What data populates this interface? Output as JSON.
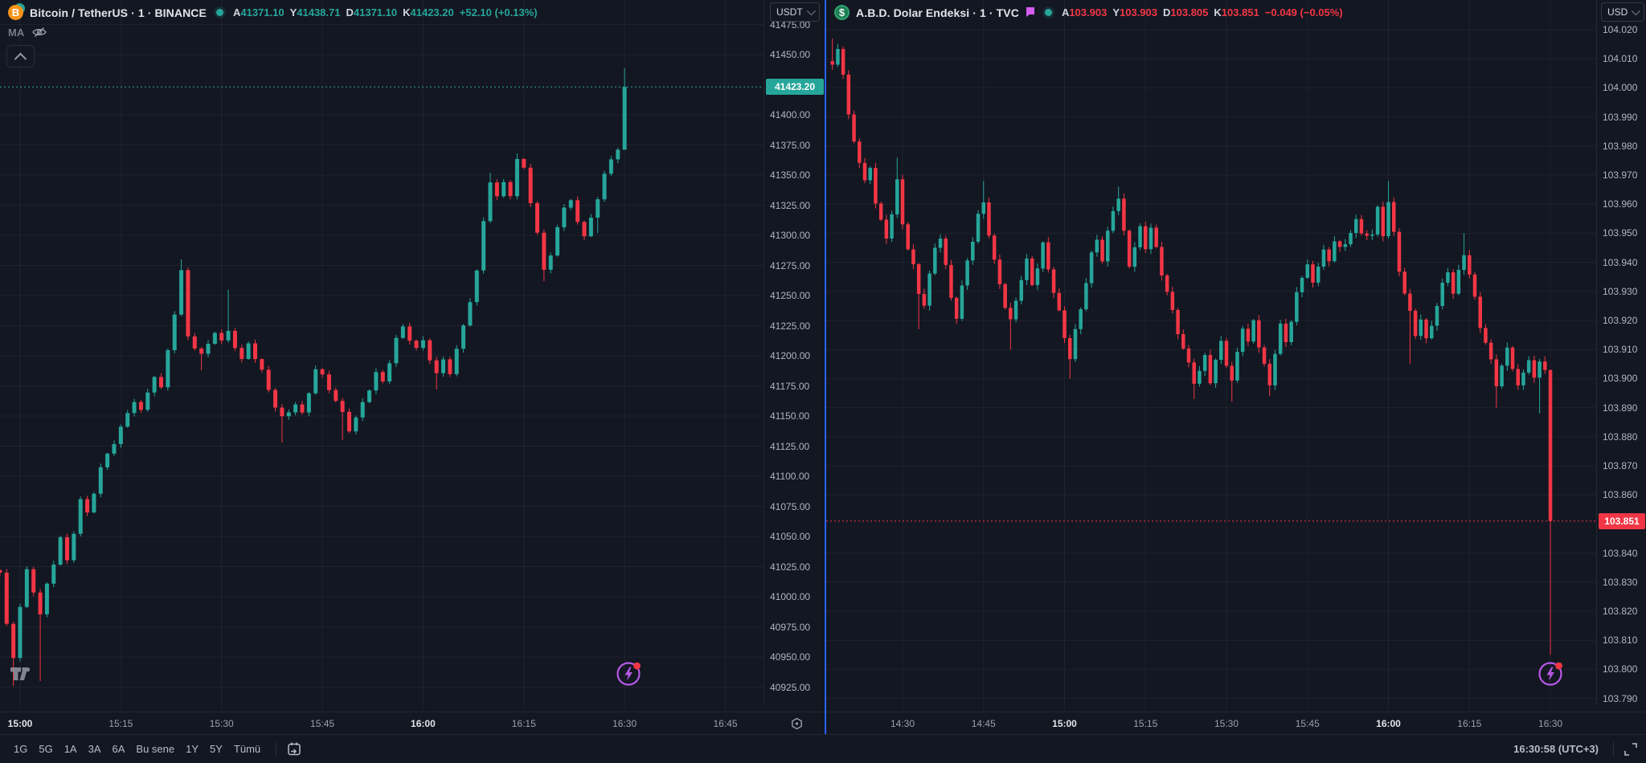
{
  "left_pane": {
    "header": {
      "title": "Bitcoin / TetherUS · 1 · BINANCE",
      "coin_glyph": "B",
      "ohlc": {
        "open_label": "A",
        "open": "41371.10",
        "high_label": "Y",
        "high": "41438.71",
        "low_label": "D",
        "low": "41371.10",
        "close_label": "K",
        "close": "41423.20",
        "change": "+52.10 (+0.13%)"
      }
    },
    "legend_indicator": "MA",
    "currency": "USDT",
    "last_price": "41423.20"
  },
  "right_pane": {
    "header": {
      "title": "A.B.D. Dolar Endeksi · 1 · TVC",
      "coin_glyph": "$",
      "ohlc": {
        "open_label": "A",
        "open": "103.903",
        "high_label": "Y",
        "high": "103.903",
        "low_label": "D",
        "low": "103.805",
        "close_label": "K",
        "close": "103.851",
        "change": "−0.049 (−0.05%)"
      }
    },
    "currency": "USD",
    "last_price": "103.851"
  },
  "toolbar": {
    "ranges": [
      "1G",
      "5G",
      "1A",
      "3A",
      "6A",
      "Bu sene",
      "1Y",
      "5Y",
      "Tümü"
    ],
    "clock": "16:30:58 (UTC+3)"
  },
  "colors": {
    "up": "#26a69a",
    "down": "#f23645",
    "accent_blue": "#2962ff",
    "flag_purple": "#d65cf0",
    "bolt_purple": "#b558e6"
  },
  "chart_data": [
    {
      "type": "candlestick",
      "title": "Bitcoin / TetherUS",
      "exchange": "BINANCE",
      "interval": "1",
      "currency": "USDT",
      "decimals": 2,
      "last_candle": {
        "open": 41371.1,
        "high": 41438.71,
        "low": 41371.1,
        "close": 41423.2
      },
      "price_line": 41423.2,
      "ylim": [
        40895,
        41485
      ],
      "y_ticks": [
        41475,
        41450,
        41400,
        41375,
        41350,
        41325,
        41300,
        41275,
        41250,
        41225,
        41200,
        41175,
        41150,
        41125,
        41100,
        41075,
        41050,
        41025,
        41000,
        40975,
        40950,
        40925
      ],
      "x_labels": [
        {
          "t": 3,
          "label": "15:00",
          "bold": true
        },
        {
          "t": 18,
          "label": "15:15",
          "bold": false
        },
        {
          "t": 33,
          "label": "15:30",
          "bold": false
        },
        {
          "t": 48,
          "label": "15:45",
          "bold": false
        },
        {
          "t": 63,
          "label": "16:00",
          "bold": true
        },
        {
          "t": 78,
          "label": "16:15",
          "bold": false
        },
        {
          "t": 93,
          "label": "16:30",
          "bold": false
        },
        {
          "t": 108,
          "label": "16:45",
          "bold": false
        }
      ],
      "path": [
        [
          0,
          41020
        ],
        [
          1,
          40975
        ],
        [
          2,
          40950
        ],
        [
          3,
          40990
        ],
        [
          4,
          41020
        ],
        [
          5,
          41005
        ],
        [
          6,
          40985
        ],
        [
          7,
          41010
        ],
        [
          9,
          41050
        ],
        [
          10,
          41030
        ],
        [
          12,
          41080
        ],
        [
          13,
          41068
        ],
        [
          15,
          41105
        ],
        [
          18,
          41140
        ],
        [
          20,
          41165
        ],
        [
          21,
          41155
        ],
        [
          23,
          41185
        ],
        [
          24,
          41172
        ],
        [
          26,
          41235
        ],
        [
          27,
          41268
        ],
        [
          28,
          41215
        ],
        [
          30,
          41200
        ],
        [
          32,
          41222
        ],
        [
          33,
          41212
        ],
        [
          34,
          41222
        ],
        [
          36,
          41195
        ],
        [
          37,
          41210
        ],
        [
          39,
          41185
        ],
        [
          41,
          41158
        ],
        [
          42,
          41148
        ],
        [
          44,
          41162
        ],
        [
          45,
          41152
        ],
        [
          47,
          41190
        ],
        [
          48,
          41182
        ],
        [
          50,
          41162
        ],
        [
          51,
          41150
        ],
        [
          52,
          41138
        ],
        [
          54,
          41160
        ],
        [
          56,
          41188
        ],
        [
          57,
          41178
        ],
        [
          59,
          41215
        ],
        [
          60,
          41222
        ],
        [
          62,
          41205
        ],
        [
          63,
          41210
        ],
        [
          65,
          41185
        ],
        [
          66,
          41196
        ],
        [
          67,
          41188
        ],
        [
          69,
          41225
        ],
        [
          71,
          41270
        ],
        [
          72,
          41310
        ],
        [
          73,
          41345
        ],
        [
          74,
          41330
        ],
        [
          75,
          41342
        ],
        [
          76,
          41334
        ],
        [
          77,
          41362
        ],
        [
          78,
          41356
        ],
        [
          79,
          41330
        ],
        [
          80,
          41302
        ],
        [
          81,
          41272
        ],
        [
          82,
          41286
        ],
        [
          83,
          41305
        ],
        [
          84,
          41322
        ],
        [
          85,
          41330
        ],
        [
          86,
          41308
        ],
        [
          87,
          41298
        ],
        [
          88,
          41316
        ],
        [
          89,
          41328
        ],
        [
          90,
          41352
        ],
        [
          91,
          41366
        ],
        [
          92,
          41371.1
        ],
        [
          93,
          41423.2
        ]
      ],
      "wicks": [
        {
          "t": 2,
          "low": 40926
        },
        {
          "t": 6,
          "low": 40930
        },
        {
          "t": 27,
          "high": 41280
        },
        {
          "t": 30,
          "low": 41188
        },
        {
          "t": 34,
          "high": 41255
        },
        {
          "t": 42,
          "low": 41128
        },
        {
          "t": 51,
          "low": 41130
        },
        {
          "t": 65,
          "low": 41172
        },
        {
          "t": 73,
          "high": 41352
        },
        {
          "t": 77,
          "high": 41368
        },
        {
          "t": 81,
          "low": 41262
        },
        {
          "t": 89,
          "low": 41302
        }
      ]
    },
    {
      "type": "candlestick",
      "title": "A.B.D. Dolar Endeksi",
      "exchange": "TVC",
      "interval": "1",
      "currency": "USD",
      "decimals": 3,
      "last_candle": {
        "open": 103.903,
        "high": 103.903,
        "low": 103.805,
        "close": 103.851
      },
      "price_line": 103.851,
      "ylim": [
        103.782,
        104.028
      ],
      "y_ticks": [
        104.02,
        104.01,
        104.0,
        103.99,
        103.98,
        103.97,
        103.96,
        103.95,
        103.94,
        103.93,
        103.92,
        103.91,
        103.9,
        103.89,
        103.88,
        103.87,
        103.86,
        103.84,
        103.83,
        103.82,
        103.81,
        103.8,
        103.79
      ],
      "x_labels": [
        {
          "t": 13,
          "label": "14:30",
          "bold": false
        },
        {
          "t": 28,
          "label": "14:45",
          "bold": false
        },
        {
          "t": 43,
          "label": "15:00",
          "bold": true
        },
        {
          "t": 58,
          "label": "15:15",
          "bold": false
        },
        {
          "t": 73,
          "label": "15:30",
          "bold": false
        },
        {
          "t": 88,
          "label": "15:45",
          "bold": false
        },
        {
          "t": 103,
          "label": "16:00",
          "bold": true
        },
        {
          "t": 118,
          "label": "16:15",
          "bold": false
        },
        {
          "t": 133,
          "label": "16:30",
          "bold": false
        }
      ],
      "path": [
        [
          0,
          104.008
        ],
        [
          1,
          104.012
        ],
        [
          2,
          104.005
        ],
        [
          3,
          103.99
        ],
        [
          4,
          103.98
        ],
        [
          5,
          103.975
        ],
        [
          6,
          103.968
        ],
        [
          7,
          103.972
        ],
        [
          8,
          103.962
        ],
        [
          10,
          103.948
        ],
        [
          11,
          103.958
        ],
        [
          12,
          103.968
        ],
        [
          13,
          103.952
        ],
        [
          15,
          103.938
        ],
        [
          16,
          103.928
        ],
        [
          17,
          103.926
        ],
        [
          19,
          103.945
        ],
        [
          20,
          103.95
        ],
        [
          22,
          103.928
        ],
        [
          23,
          103.922
        ],
        [
          25,
          103.94
        ],
        [
          27,
          103.955
        ],
        [
          28,
          103.96
        ],
        [
          30,
          103.94
        ],
        [
          32,
          103.926
        ],
        [
          33,
          103.92
        ],
        [
          35,
          103.935
        ],
        [
          36,
          103.94
        ],
        [
          37,
          103.932
        ],
        [
          38,
          103.938
        ],
        [
          39,
          103.945
        ],
        [
          41,
          103.93
        ],
        [
          43,
          103.915
        ],
        [
          44,
          103.908
        ],
        [
          46,
          103.925
        ],
        [
          48,
          103.942
        ],
        [
          49,
          103.948
        ],
        [
          50,
          103.94
        ],
        [
          52,
          103.958
        ],
        [
          53,
          103.962
        ],
        [
          54,
          103.95
        ],
        [
          55,
          103.94
        ],
        [
          57,
          103.952
        ],
        [
          58,
          103.946
        ],
        [
          59,
          103.952
        ],
        [
          61,
          103.936
        ],
        [
          63,
          103.922
        ],
        [
          65,
          103.91
        ],
        [
          67,
          103.9
        ],
        [
          68,
          103.903
        ],
        [
          69,
          103.908
        ],
        [
          70,
          103.9
        ],
        [
          72,
          103.912
        ],
        [
          73,
          103.905
        ],
        [
          74,
          103.898
        ],
        [
          76,
          103.918
        ],
        [
          77,
          103.912
        ],
        [
          78,
          103.92
        ],
        [
          80,
          103.905
        ],
        [
          81,
          103.898
        ],
        [
          82,
          103.91
        ],
        [
          83,
          103.918
        ],
        [
          84,
          103.912
        ],
        [
          86,
          103.928
        ],
        [
          88,
          103.94
        ],
        [
          89,
          103.932
        ],
        [
          91,
          103.946
        ],
        [
          92,
          103.94
        ],
        [
          93,
          103.948
        ],
        [
          95,
          103.945
        ],
        [
          97,
          103.955
        ],
        [
          98,
          103.948
        ],
        [
          100,
          103.95
        ],
        [
          101,
          103.958
        ],
        [
          102,
          103.95
        ],
        [
          103,
          103.962
        ],
        [
          104,
          103.95
        ],
        [
          105,
          103.938
        ],
        [
          107,
          103.922
        ],
        [
          108,
          103.915
        ],
        [
          109,
          103.92
        ],
        [
          110,
          103.912
        ],
        [
          112,
          103.925
        ],
        [
          113,
          103.932
        ],
        [
          114,
          103.938
        ],
        [
          115,
          103.93
        ],
        [
          117,
          103.944
        ],
        [
          118,
          103.936
        ],
        [
          120,
          103.918
        ],
        [
          122,
          103.905
        ],
        [
          123,
          103.898
        ],
        [
          124,
          103.904
        ],
        [
          125,
          103.91
        ],
        [
          126,
          103.905
        ],
        [
          127,
          103.898
        ],
        [
          128,
          103.902
        ],
        [
          129,
          103.908
        ],
        [
          130,
          103.9
        ],
        [
          131,
          103.905
        ],
        [
          132,
          103.903
        ],
        [
          133,
          103.851
        ]
      ],
      "wicks": [
        {
          "t": 0,
          "high": 104.017
        },
        {
          "t": 12,
          "high": 103.976
        },
        {
          "t": 16,
          "low": 103.917
        },
        {
          "t": 28,
          "high": 103.968
        },
        {
          "t": 33,
          "low": 103.91
        },
        {
          "t": 44,
          "low": 103.9
        },
        {
          "t": 53,
          "high": 103.966
        },
        {
          "t": 67,
          "low": 103.893
        },
        {
          "t": 74,
          "low": 103.892
        },
        {
          "t": 81,
          "low": 103.894
        },
        {
          "t": 103,
          "high": 103.968
        },
        {
          "t": 107,
          "low": 103.905
        },
        {
          "t": 117,
          "high": 103.95
        },
        {
          "t": 123,
          "low": 103.89
        },
        {
          "t": 131,
          "low": 103.888
        }
      ]
    }
  ]
}
